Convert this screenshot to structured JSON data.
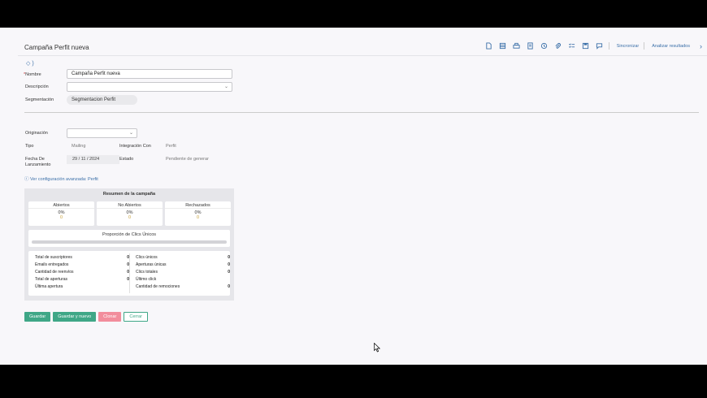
{
  "page": {
    "title": "Campaña Perfit nueva",
    "tag_glyph": "◇ )"
  },
  "toolbar": {
    "icons": [
      "new-document-icon",
      "spreadsheet-icon",
      "print-icon",
      "report-icon",
      "history-icon",
      "attachment-icon",
      "checklist-icon",
      "save-icon",
      "comment-icon"
    ],
    "sync_label": "Sincronizar",
    "analyze_label": "Analizar resultados",
    "more_glyph": "›"
  },
  "form": {
    "nombre_label": "Nombre",
    "nombre_value": "Campaña Perfit nueva",
    "descripcion_label": "Descripción",
    "descripcion_value": "",
    "segmentacion_label": "Segmentación",
    "segmentacion_value": "Segmentacion Perfit",
    "originacion_label": "Originación",
    "originacion_value": "",
    "tipo_label": "Tipo",
    "tipo_value": "Mailing",
    "integracion_label": "Integración Con",
    "integracion_value": "Perfit",
    "fecha_label_1": "Fecha De",
    "fecha_label_2": "Lanzamiento",
    "fecha_value": "29 / 11 / 2024",
    "estado_label": "Estado",
    "estado_value": "Pendiente de generar",
    "advanced_link": "Ver configuración avanzada: Perfit"
  },
  "summary": {
    "title": "Resumen de la campaña",
    "kpis": [
      {
        "label": "Abiertos",
        "pct": "0%",
        "count": "0"
      },
      {
        "label": "No Abiertos",
        "pct": "0%",
        "count": "0"
      },
      {
        "label": "Rechazados",
        "pct": "0%",
        "count": "0"
      }
    ],
    "ratio_title": "Proporción de Clics Únicos",
    "ratio_fraction": 0,
    "left_stats": [
      {
        "label": "Total de suscriptores",
        "value": "0"
      },
      {
        "label": "Emails entregados",
        "value": "0"
      },
      {
        "label": "Cantidad de reenvíos",
        "value": "0"
      },
      {
        "label": "Total de aperturas",
        "value": "0"
      },
      {
        "label": "Última apertura",
        "value": ""
      }
    ],
    "right_stats": [
      {
        "label": "Clics únicos",
        "value": "0"
      },
      {
        "label": "Aperturas únicas",
        "value": "0"
      },
      {
        "label": "Clics totales",
        "value": "0"
      },
      {
        "label": "Último click",
        "value": ""
      },
      {
        "label": "Cantidad de remociones",
        "value": "0"
      }
    ]
  },
  "buttons": {
    "guardar": "Guardar",
    "guardar_nuevo": "Guardar y nuevo",
    "clonar": "Clonar",
    "cerrar": "Cerrar"
  },
  "colors": {
    "accent": "#3fa787",
    "danger": "#f28d9c",
    "link": "#3a6fa8",
    "count": "#c9a23a"
  }
}
